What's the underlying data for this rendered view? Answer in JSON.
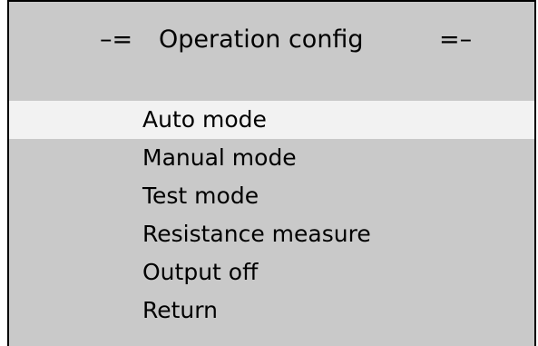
{
  "header": {
    "left_decor": "–=",
    "title": "Operation config",
    "right_decor": "=–"
  },
  "menu": {
    "selected_index": 0,
    "items": [
      {
        "label": "Auto mode"
      },
      {
        "label": "Manual mode"
      },
      {
        "label": "Test mode"
      },
      {
        "label": "Resistance measure"
      },
      {
        "label": "Output off"
      },
      {
        "label": "Return"
      }
    ]
  },
  "colors": {
    "panel_background": "#c9c9c9",
    "selected_background": "#f2f2f2",
    "text": "#000000",
    "border": "#000000"
  }
}
